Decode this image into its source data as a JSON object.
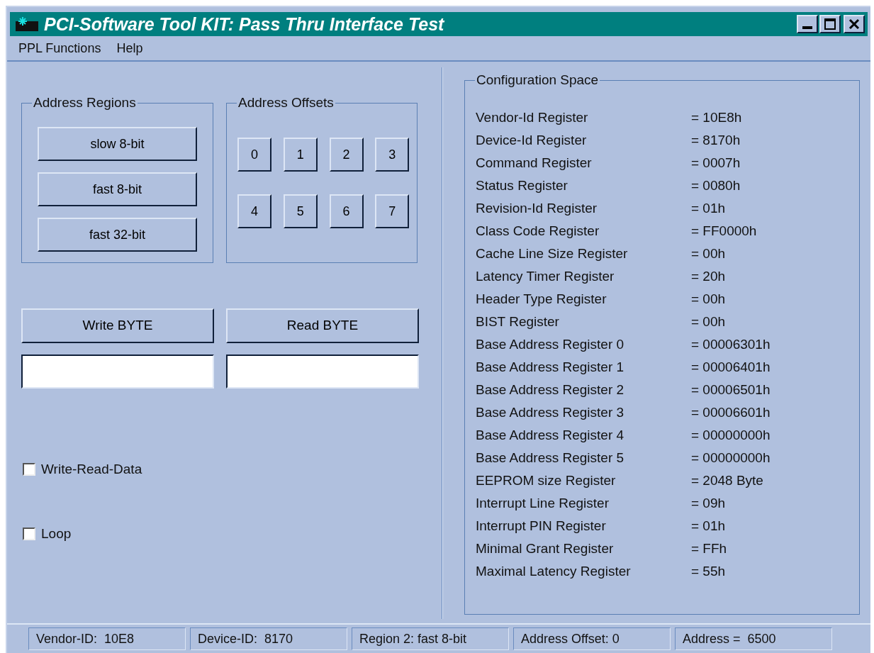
{
  "window": {
    "title": "PCI-Software Tool KIT: Pass Thru Interface Test"
  },
  "menu": [
    "PPL Functions",
    "Help"
  ],
  "address_regions": {
    "title": "Address Regions",
    "buttons": [
      "slow 8-bit",
      "fast 8-bit",
      "fast 32-bit"
    ]
  },
  "address_offsets": {
    "title": "Address Offsets",
    "buttons": [
      "0",
      "1",
      "2",
      "3",
      "4",
      "5",
      "6",
      "7"
    ]
  },
  "actions": [
    {
      "label": "Write BYTE"
    },
    {
      "label": "Read BYTE"
    }
  ],
  "checkboxes": [
    {
      "label": "Write-Read-Data",
      "checked": false
    },
    {
      "label": "Loop",
      "checked": false
    }
  ],
  "config": {
    "title": "Configuration Space",
    "rows": [
      {
        "label": "Vendor-Id Register",
        "value": "= 10E8h"
      },
      {
        "label": "Device-Id Register",
        "value": "= 8170h"
      },
      {
        "label": "Command Register",
        "value": "= 0007h"
      },
      {
        "label": "Status Register",
        "value": "= 0080h"
      },
      {
        "label": "Revision-Id Register",
        "value": "= 01h"
      },
      {
        "label": "Class Code Register",
        "value": "= FF0000h"
      },
      {
        "label": "Cache Line Size Register",
        "value": "= 00h"
      },
      {
        "label": "Latency Timer Register",
        "value": "= 20h"
      },
      {
        "label": "Header Type Register",
        "value": "= 00h"
      },
      {
        "label": "BIST Register",
        "value": "= 00h"
      },
      {
        "label": "Base Address Register 0",
        "value": "= 00006301h"
      },
      {
        "label": "Base Address Register 1",
        "value": "= 00006401h"
      },
      {
        "label": "Base Address Register 2",
        "value": "= 00006501h"
      },
      {
        "label": "Base Address Register 3",
        "value": "= 00006601h"
      },
      {
        "label": "Base Address Register 4",
        "value": "= 00000000h"
      },
      {
        "label": "Base Address Register 5",
        "value": "= 00000000h"
      },
      {
        "label": "EEPROM size Register",
        "value": "= 2048 Byte"
      },
      {
        "label": "Interrupt Line Register",
        "value": "= 09h"
      },
      {
        "label": "Interrupt PIN Register",
        "value": "= 01h"
      },
      {
        "label": "Minimal Grant Register",
        "value": "= FFh"
      },
      {
        "label": "Maximal Latency Register",
        "value": "= 55h"
      }
    ]
  },
  "status_bar": [
    "Vendor-ID:  10E8",
    "Device-ID:  8170",
    "Region 2: fast 8-bit",
    "Address Offset: 0",
    "Address =  6500"
  ]
}
